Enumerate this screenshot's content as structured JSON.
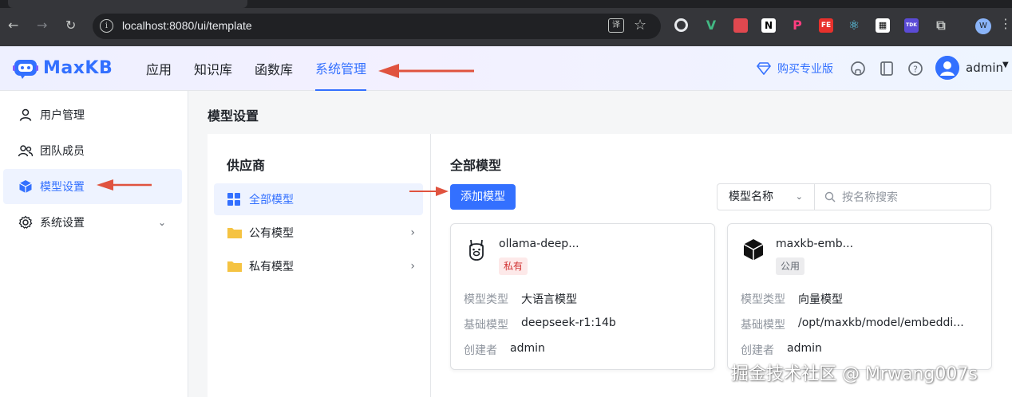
{
  "browser": {
    "url": "localhost:8080/ui/template",
    "profile_initial": "W",
    "extensions": [
      "circle-ext-icon",
      "vue-devtools-icon",
      "translate-ext-icon",
      "notion-icon",
      "p-ext-icon",
      "fe-ext-icon",
      "react-devtools-icon",
      "qr-ext-icon",
      "tdk-ext-icon",
      "puzzle-icon"
    ],
    "ext_labels": {
      "fe": "FE",
      "tdk": "TDK",
      "translate": "译"
    }
  },
  "header": {
    "logo_text": "MaxKB",
    "nav": [
      {
        "label": "应用"
      },
      {
        "label": "知识库"
      },
      {
        "label": "函数库"
      },
      {
        "label": "系统管理",
        "active": true
      }
    ],
    "buy_pro": "购买专业版",
    "user_name": "admin"
  },
  "sidebar": {
    "items": [
      {
        "label": "用户管理",
        "icon": "user-icon"
      },
      {
        "label": "团队成员",
        "icon": "team-icon"
      },
      {
        "label": "模型设置",
        "icon": "cube-icon",
        "active": true
      },
      {
        "label": "系统设置",
        "icon": "gear-icon",
        "expandable": true
      }
    ]
  },
  "main": {
    "title": "模型设置",
    "provider_title": "供应商",
    "providers": [
      {
        "label": "全部模型",
        "icon": "grid-icon",
        "active": true
      },
      {
        "label": "公有模型",
        "icon": "folder-icon",
        "expandable": true
      },
      {
        "label": "私有模型",
        "icon": "folder-icon",
        "expandable": true
      }
    ],
    "models_title": "全部模型",
    "add_button": "添加模型",
    "filter_select": "模型名称",
    "search_placeholder": "按名称搜索",
    "cards": [
      {
        "name": "ollama-deep...",
        "icon": "llama-icon",
        "tag": "私有",
        "tag_type": "private",
        "rows": [
          {
            "key": "模型类型",
            "value": "大语言模型"
          },
          {
            "key": "基础模型",
            "value": "deepseek-r1:14b"
          },
          {
            "key": "创建者",
            "value": "admin"
          }
        ]
      },
      {
        "name": "maxkb-emb...",
        "icon": "cube-icon",
        "tag": "公用",
        "tag_type": "public",
        "rows": [
          {
            "key": "模型类型",
            "value": "向量模型"
          },
          {
            "key": "基础模型",
            "value": "/opt/maxkb/model/embeddi..."
          },
          {
            "key": "创建者",
            "value": "admin"
          }
        ]
      }
    ]
  },
  "watermark": "掘金技术社区 @ Mrwang007s",
  "colors": {
    "accent": "#3370ff",
    "annotation_arrow": "#e0533f",
    "folder": "#f5c342"
  }
}
